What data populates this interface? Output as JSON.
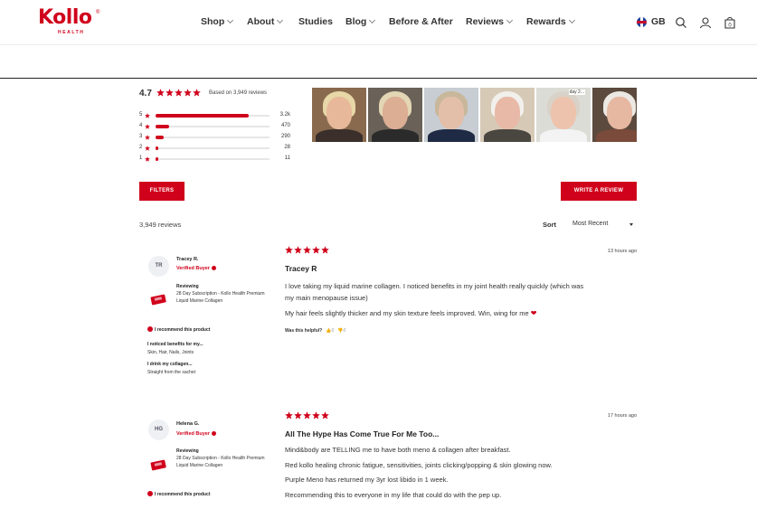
{
  "brand": {
    "name": "Kollo",
    "sub": "HEALTH",
    "reg": "®",
    "color": "#d0021b"
  },
  "nav": {
    "items": [
      {
        "label": "Shop",
        "dropdown": true
      },
      {
        "label": "About",
        "dropdown": true
      },
      {
        "label": "Studies",
        "dropdown": false
      },
      {
        "label": "Blog",
        "dropdown": true
      },
      {
        "label": "Before & After",
        "dropdown": false
      },
      {
        "label": "Reviews",
        "dropdown": true
      },
      {
        "label": "Rewards",
        "dropdown": true
      }
    ],
    "region": "GB",
    "icons": [
      "search-icon",
      "account-icon",
      "cart-icon"
    ],
    "cart_count": "0"
  },
  "summary": {
    "average": "4.7",
    "based_on": "Based on 3,949 reviews",
    "rows": [
      {
        "stars": "5",
        "count": "3.2k",
        "fraction": 0.82
      },
      {
        "stars": "4",
        "count": "470",
        "fraction": 0.12
      },
      {
        "stars": "3",
        "count": "290",
        "fraction": 0.07
      },
      {
        "stars": "2",
        "count": "28",
        "fraction": 0.02
      },
      {
        "stars": "1",
        "count": "11",
        "fraction": 0.01
      }
    ],
    "photo_tag": "day 2..."
  },
  "actions": {
    "filters": "FILTERS",
    "write_review": "WRITE A REVIEW"
  },
  "list": {
    "count": "3,949 reviews",
    "sort_label": "Sort",
    "sort_value": "Most Recent"
  },
  "reviews": [
    {
      "initials": "TR",
      "name": "Tracey R.",
      "verified": "Verified Buyer",
      "reviewing": "Reviewing",
      "product": "28 Day Subscription - Kollo Health Premium Liquid Marine Collagen",
      "recommend": "I recommend this product",
      "q1": "I noticed benefits for my...",
      "a1": "Skin, Hair, Nails, Joints",
      "q2": "I drink my collagen...",
      "a2": "Straight from the sachet",
      "time": "13 hours ago",
      "title": "Tracey R",
      "lines": [
        "I love taking my liquid marine collagen. I noticed benefits in my joint health really quickly (which was",
        "my main menopause issue)",
        "My hair feels slightly thicker and my skin texture feels improved. Win, wing for me"
      ],
      "helpful": "Was this helpful?",
      "up": "0",
      "down": "0"
    },
    {
      "initials": "HG",
      "name": "Helena G.",
      "verified": "Verified Buyer",
      "reviewing": "Reviewing",
      "product": "28 Day Subscription - Kollo Health Premium Liquid Marine Collagen",
      "recommend": "I recommend this product",
      "time": "17 hours ago",
      "title": "All The Hype Has Come True For Me Too...",
      "lines": [
        "Mind&body are TELLING me to have both meno & collagen after breakfast.",
        "Red kollo healing chronic fatigue, sensitivities, joints clicking/popping & skin glowing now.",
        "Purple Meno has returned my 3yr lost libido in 1 week.",
        "Recommending this to everyone in my life that could do with the pep up."
      ]
    }
  ]
}
